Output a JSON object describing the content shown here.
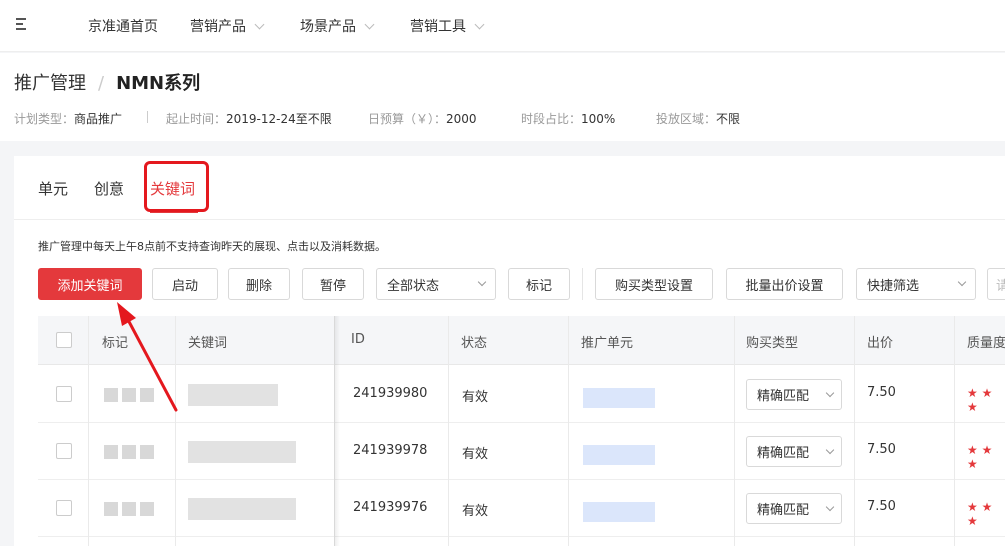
{
  "nav": {
    "items": [
      {
        "label": "京准通首页"
      },
      {
        "label": "营销产品"
      },
      {
        "label": "场景产品"
      },
      {
        "label": "营销工具"
      }
    ]
  },
  "breadcrumb": {
    "root": "推广管理",
    "separator": "/",
    "current": "NMN系列"
  },
  "plan_meta": {
    "type_key": "计划类型：",
    "type_value": "商品推广",
    "start_key": "起止时间：",
    "start_value": "2019-12-24至不限",
    "budget_key": "日预算（￥）：",
    "budget_value": "2000",
    "time_key": "时段占比：",
    "time_value": "100%",
    "region_key": "投放区域：",
    "region_value": "不限"
  },
  "tabs": [
    {
      "label": "单元"
    },
    {
      "label": "创意"
    },
    {
      "label": "关键词"
    }
  ],
  "notice": "推广管理中每天上午8点前不支持查询昨天的展现、点击以及消耗数据。",
  "toolbar": {
    "add_keyword": "添加关键词",
    "start": "启动",
    "delete": "删除",
    "pause": "暂停",
    "status_filter": "全部状态",
    "mark": "标记",
    "purchase_type": "购买类型设置",
    "bulk_bid": "批量出价设置",
    "quick_filter": "快捷筛选",
    "search_placeholder": "请"
  },
  "table": {
    "headers": {
      "mark": "标记",
      "keyword": "关键词",
      "id": "ID",
      "status": "状态",
      "unit": "推广单元",
      "purchase_type": "购买类型",
      "bid": "出价",
      "quality": "质量度"
    },
    "rows": [
      {
        "id": "241939980",
        "status": "有效",
        "match": "精确匹配",
        "bid": "7.50",
        "stars": "★ ★ ★"
      },
      {
        "id": "241939978",
        "status": "有效",
        "match": "精确匹配",
        "bid": "7.50",
        "stars": "★ ★ ★"
      },
      {
        "id": "241939976",
        "status": "有效",
        "match": "精确匹配",
        "bid": "7.50",
        "stars": "★ ★ ★"
      }
    ]
  },
  "colors": {
    "accent": "#e4393c",
    "annotation": "#e4181e",
    "link_blur": "#dbe6fb"
  }
}
